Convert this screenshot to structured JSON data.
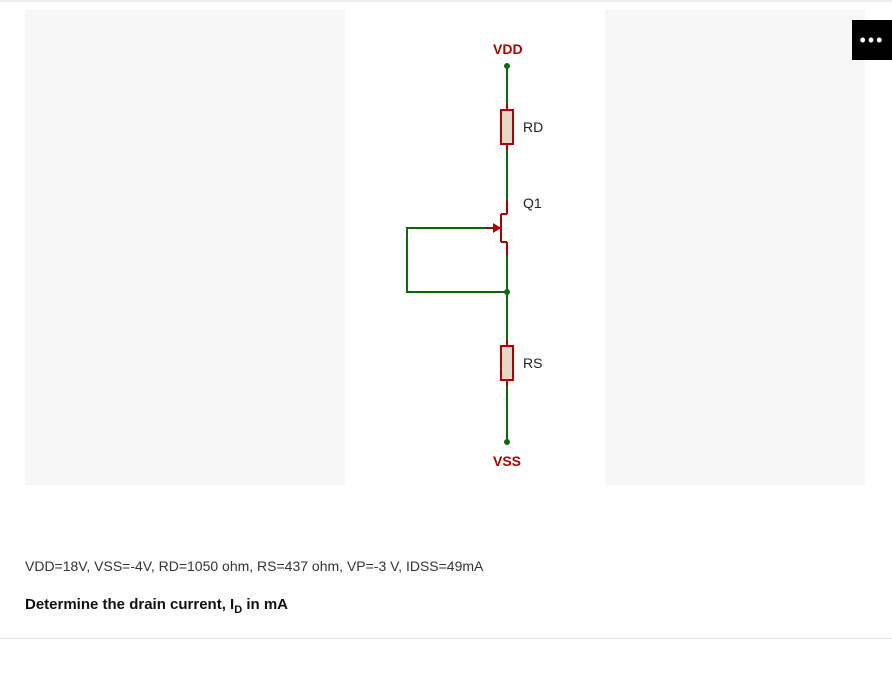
{
  "domain": "Diagram",
  "circuit": {
    "nodes": {
      "top": "VDD",
      "bottom": "VSS"
    },
    "components": {
      "rd": "RD",
      "q1": "Q1",
      "rs": "RS"
    },
    "parameters_text": "VDD=18V, VSS=-4V, RD=1050 ohm, RS=437 ohm, VP=-3 V, IDSS=49mA",
    "values": {
      "VDD_V": 18,
      "VSS_V": -4,
      "RD_ohm": 1050,
      "RS_ohm": 437,
      "VP_V": -3,
      "IDSS_mA": 49
    }
  },
  "question": {
    "prefix": "Determine the drain current, I",
    "sub": "D",
    "suffix": " in mA"
  },
  "ui": {
    "more": "•••"
  }
}
